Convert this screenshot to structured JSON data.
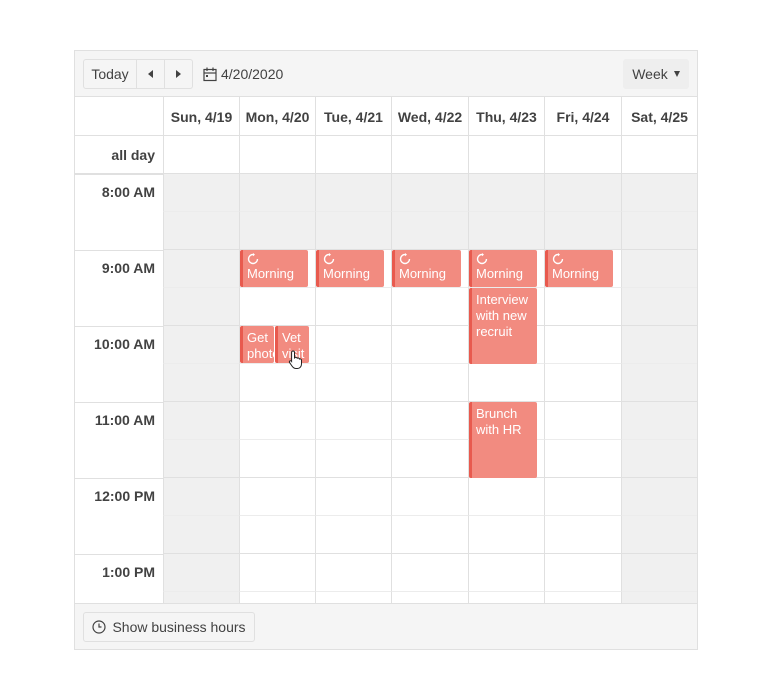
{
  "toolbar": {
    "today_label": "Today",
    "prev_icon": "chevron-left-icon",
    "next_icon": "chevron-right-icon",
    "date_icon": "calendar-icon",
    "date_label": "4/20/2020",
    "view_label": "Week"
  },
  "header": {
    "days": [
      "Sun, 4/19",
      "Mon, 4/20",
      "Tue, 4/21",
      "Wed, 4/22",
      "Thu, 4/23",
      "Fri, 4/24",
      "Sat, 4/25"
    ]
  },
  "allday": {
    "label": "all day"
  },
  "times": [
    "8:00 AM",
    "9:00 AM",
    "10:00 AM",
    "11:00 AM",
    "12:00 PM",
    "1:00 PM"
  ],
  "appointments": [
    {
      "title": "Morning",
      "recurring": true
    },
    {
      "title": "Morning",
      "recurring": true
    },
    {
      "title": "Morning",
      "recurring": true
    },
    {
      "title": "Morning",
      "recurring": true
    },
    {
      "title": "Morning",
      "recurring": true
    },
    {
      "title": "Interview with new recruit",
      "recurring": false
    },
    {
      "title": "Get photo",
      "recurring": false
    },
    {
      "title": "Vet visit",
      "recurring": false
    },
    {
      "title": "Brunch with HR",
      "recurring": false
    }
  ],
  "footer": {
    "business_hours_label": "Show business hours",
    "clock_icon": "clock-icon"
  },
  "colors": {
    "appointment": "#f28b80",
    "appointment_border": "#e85a4e",
    "off_hours": "#f0f0f0",
    "toolbar": "#f5f5f5"
  }
}
